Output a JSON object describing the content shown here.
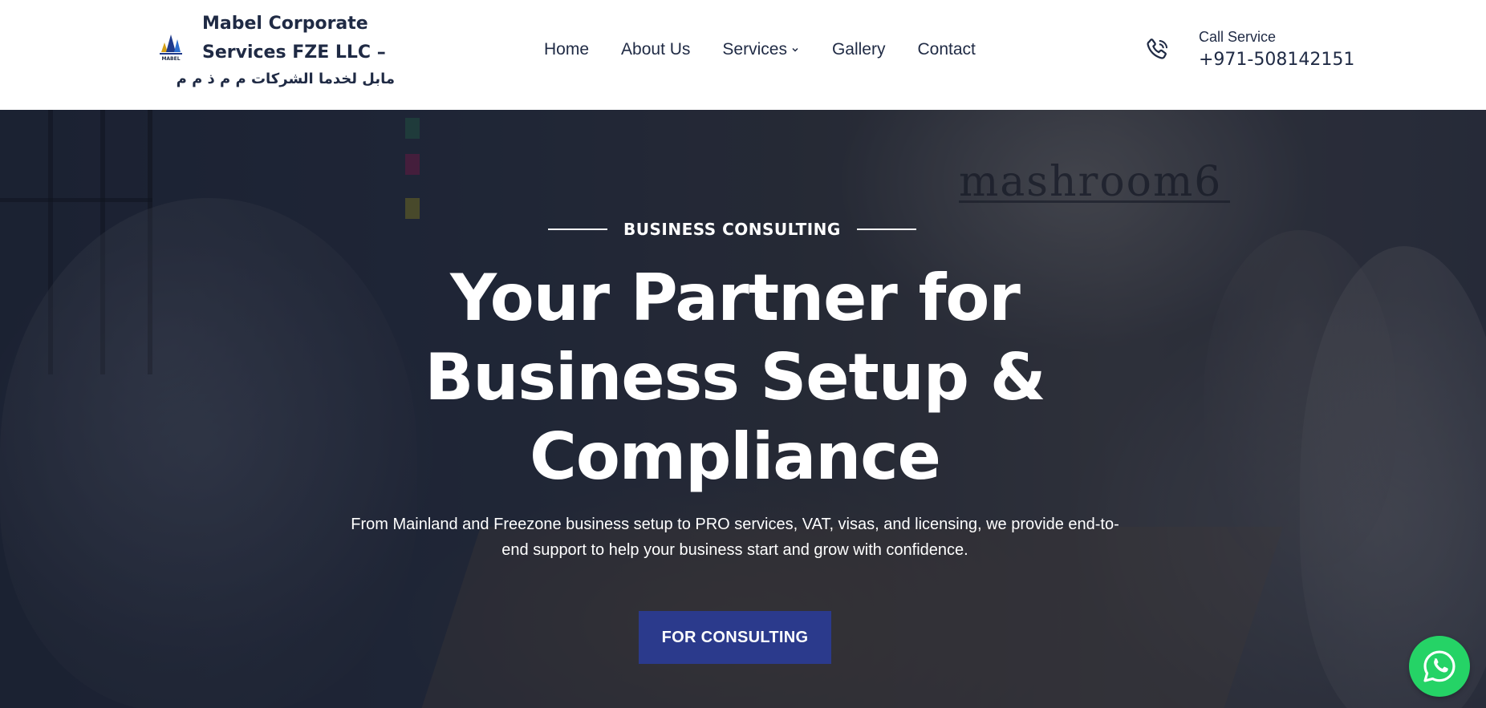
{
  "header": {
    "brand_line1": "Mabel Corporate",
    "brand_line2": "Services FZE LLC –",
    "brand_arabic": "مابل لخدما الشركات م م ذ م م",
    "logo_text": "MABEL",
    "nav": [
      {
        "label": "Home"
      },
      {
        "label": "About Us"
      },
      {
        "label": "Services"
      },
      {
        "label": "Gallery"
      },
      {
        "label": "Contact"
      }
    ],
    "call_label": "Call Service",
    "call_number": "+971-508142151"
  },
  "hero": {
    "eyebrow": "BUSINESS CONSULTING",
    "headline_line1": "Your Partner for",
    "headline_line2": "Business Setup &",
    "headline_line3": "Compliance",
    "subtext_line1": "From Mainland and Freezone business setup to PRO services, VAT, visas, and licensing, we provide end-to-",
    "subtext_line2": "end support to help your business start and grow with confidence.",
    "cta_label": "FOR CONSULTING",
    "background_sign": "mashroom6"
  },
  "colors": {
    "brand_navy": "#1f2a44",
    "cta_blue": "#2b3a8c",
    "whatsapp_green": "#25d366"
  },
  "icons": {
    "phone": "phone-icon",
    "chevron": "chevron-down-icon",
    "whatsapp": "whatsapp-icon",
    "logo": "mabel-logo"
  }
}
